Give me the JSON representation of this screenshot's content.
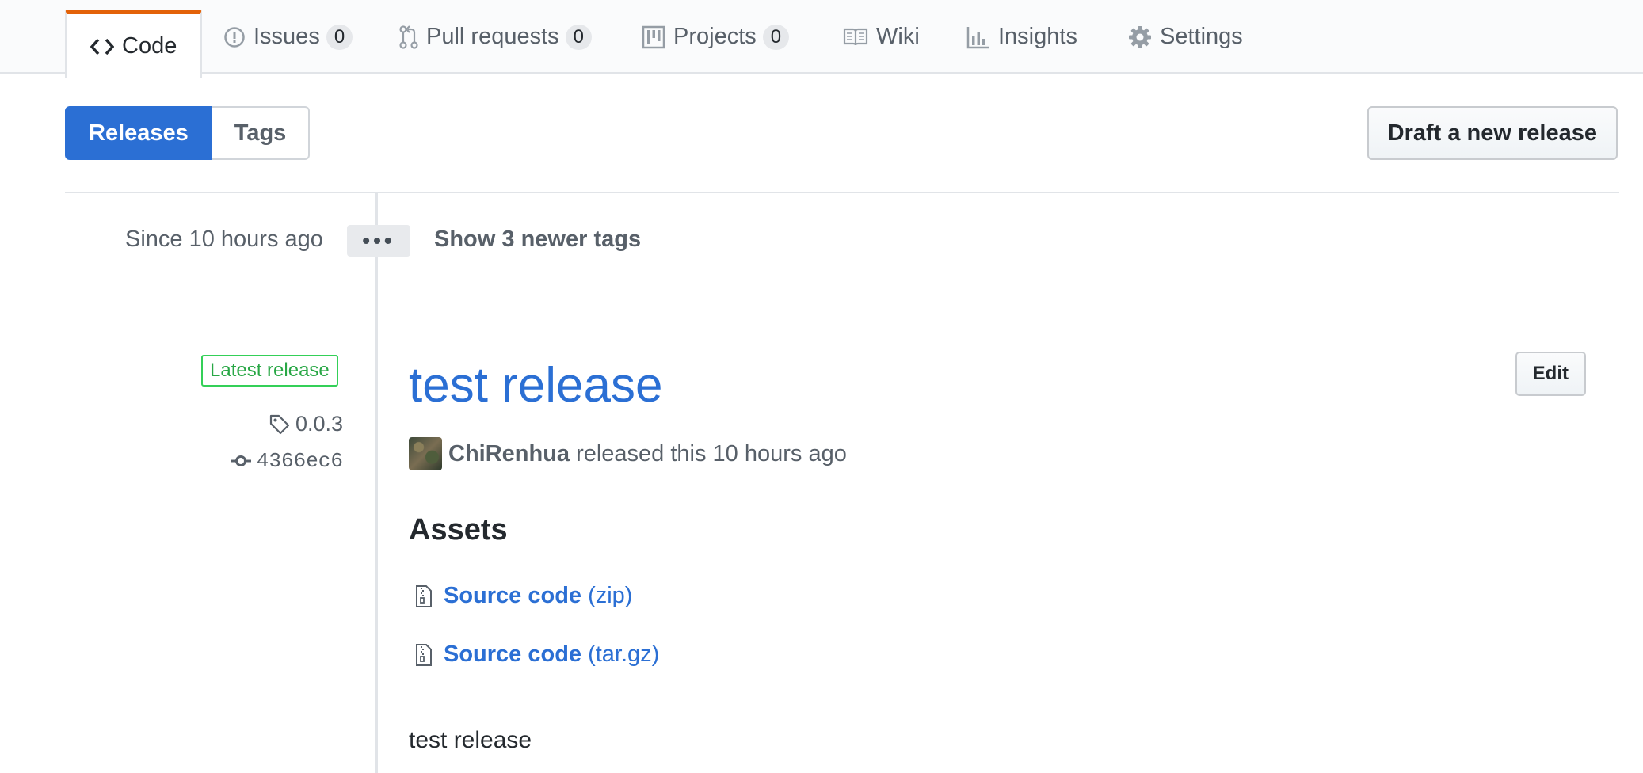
{
  "repo_nav": {
    "tabs": [
      {
        "label": "Code",
        "icon": "code-icon",
        "selected": true
      },
      {
        "label": "Issues",
        "icon": "issue-icon",
        "counter": "0"
      },
      {
        "label": "Pull requests",
        "icon": "pull-request-icon",
        "counter": "0"
      },
      {
        "label": "Projects",
        "icon": "project-icon",
        "counter": "0"
      },
      {
        "label": "Wiki",
        "icon": "book-icon"
      },
      {
        "label": "Insights",
        "icon": "graph-icon"
      },
      {
        "label": "Settings",
        "icon": "gear-icon"
      }
    ]
  },
  "subnav": {
    "releases": "Releases",
    "tags": "Tags"
  },
  "draft_button": "Draft a new release",
  "timeline": {
    "since": "Since 10 hours ago",
    "ellipsis": "•••",
    "newer_tags": "Show 3 newer tags"
  },
  "release": {
    "latest_label": "Latest release",
    "tag": "0.0.3",
    "commit": "4366ec6",
    "title": "test release",
    "edit": "Edit",
    "author": "ChiRenhua",
    "released_text": "released this 10 hours ago",
    "assets_heading": "Assets",
    "assets": [
      {
        "label": "Source code",
        "ext": "(zip)"
      },
      {
        "label": "Source code",
        "ext": "(tar.gz)"
      }
    ],
    "body": "test release"
  },
  "colors": {
    "link_blue": "#2b6fd4",
    "tab_accent": "#e36209",
    "latest_green": "#28a745"
  }
}
